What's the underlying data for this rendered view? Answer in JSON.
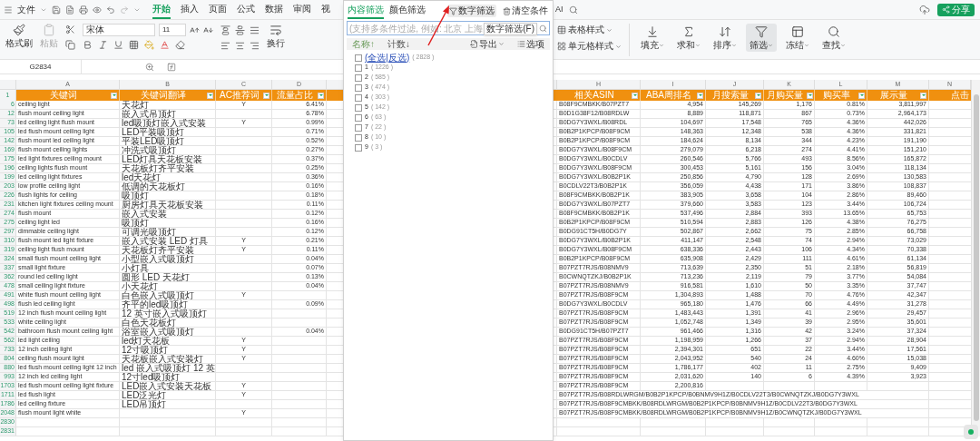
{
  "menu": {
    "file": "文件",
    "tabs": [
      {
        "label": "开始",
        "selected": true
      },
      {
        "label": "插入",
        "selected": false
      },
      {
        "label": "页面",
        "selected": false
      },
      {
        "label": "公式",
        "selected": false
      },
      {
        "label": "数据",
        "selected": false
      },
      {
        "label": "审阅",
        "selected": false
      },
      {
        "label": "视",
        "selected": false
      }
    ],
    "tail": "AI",
    "share": "分享"
  },
  "ribbon": {
    "format_painter": "格式刷",
    "paste": "粘贴",
    "font": "宋体",
    "size": "11",
    "wrap": "换行",
    "table_style": "表格样式",
    "cell_style": "单元格样式",
    "tools": [
      {
        "label": "填充",
        "active": false
      },
      {
        "label": "求和",
        "active": false
      },
      {
        "label": "排序",
        "active": false
      },
      {
        "label": "筛选",
        "active": true
      },
      {
        "label": "冻结",
        "active": false
      },
      {
        "label": "查找",
        "active": false
      }
    ]
  },
  "formula_bar": {
    "cell": "G2834"
  },
  "left_columns": [
    "A",
    "B",
    "C",
    "D"
  ],
  "right_columns": [
    "H",
    "I",
    "J",
    "K",
    "L",
    "M",
    "N"
  ],
  "header_row": "1",
  "headers_left": [
    "关键词",
    "关键词翻译",
    "AC推荐词",
    "流量占比"
  ],
  "headers_right": [
    "相关ASIN",
    "ABA周排名",
    "月搜索量",
    "月购买量",
    "购买率",
    "展示量",
    "点击"
  ],
  "rows": [
    {
      "n": "6",
      "kw": "ceiling light",
      "tr": "天花灯",
      "ac": "Y",
      "share": "6.41%",
      "asin": "B08F9CMBKK/B07PZT7",
      "rank": "4,954",
      "search": "145,269",
      "buy": "1,176",
      "rate": "0.81%",
      "views": "3,811,997"
    },
    {
      "n": "12",
      "kw": "flush mount ceiling light",
      "tr": "嵌入式吊顶灯",
      "share": "6.78%",
      "asin": "B0D1G38F12/B08RDLW",
      "rank": "8,889",
      "search": "118,871",
      "buy": "867",
      "rate": "0.73%",
      "views": "2,964,173"
    },
    {
      "n": "73",
      "kw": "led ceiling light flush mount",
      "tr": "led吸顶灯嵌入式安装",
      "ac": "Y",
      "share": "0.99%",
      "asin": "B0DG7Y3WXL/B08RDL",
      "rank": "104,697",
      "search": "17,548",
      "buy": "765",
      "rate": "4.36%",
      "views": "442,026"
    },
    {
      "n": "105",
      "kw": "led flush mount ceiling light",
      "tr": "LED平装吸顶灯",
      "share": "0.71%",
      "asin": "B0B2P1KPCP/B08F9CM",
      "rank": "148,363",
      "search": "12,348",
      "buy": "538",
      "rate": "4.36%",
      "views": "331,821"
    },
    {
      "n": "142",
      "kw": "flush mount led ceiling light",
      "tr": "平装LED吸顶灯",
      "share": "0.52%",
      "asin": "B0B2P1KPCP/B08F9CM",
      "rank": "184,624",
      "search": "8,134",
      "buy": "344",
      "rate": "4.23%",
      "views": "191,190"
    },
    {
      "n": "169",
      "kw": "flush mount ceiling lights",
      "tr": "冲洗式吸顶灯",
      "share": "0.27%",
      "asin": "B0DG7Y3WXL/B08F9CM",
      "rank": "279,079",
      "search": "6,218",
      "buy": "274",
      "rate": "4.41%",
      "views": "151,210"
    },
    {
      "n": "175",
      "kw": "led light fixtures ceiling mount",
      "tr": "LED灯具天花板安装",
      "share": "0.37%",
      "asin": "B0DG7Y3WXL/B0CDLV",
      "rank": "260,546",
      "search": "5,766",
      "buy": "493",
      "rate": "8.56%",
      "views": "165,872"
    },
    {
      "n": "196",
      "kw": "ceiling lights flush mount",
      "tr": "天花板灯齐平安装",
      "share": "0.25%",
      "asin": "B0DG7Y3WXL/B08F9CM",
      "rank": "300,453",
      "search": "5,161",
      "buy": "156",
      "rate": "3.04%",
      "views": "118,134"
    },
    {
      "n": "199",
      "kw": "led ceiling light fixtures",
      "tr": "led天花灯",
      "share": "0.36%",
      "asin": "B0DG7Y3WXL/B0B2P1K",
      "rank": "250,856",
      "search": "4,790",
      "buy": "128",
      "rate": "2.69%",
      "views": "130,583"
    },
    {
      "n": "203",
      "kw": "low profile ceiling light",
      "tr": "低调的天花板灯",
      "share": "0.16%",
      "asin": "B0CDLV22T3/B0B2P1K",
      "rank": "356,059",
      "search": "4,438",
      "buy": "171",
      "rate": "3.86%",
      "views": "108,837"
    },
    {
      "n": "226",
      "kw": "flush lights for ceiling",
      "tr": "吸顶灯",
      "share": "0.18%",
      "asin": "B08F9CMBKK/B0B2P1K",
      "rank": "383,905",
      "search": "3,658",
      "buy": "104",
      "rate": "2.86%",
      "views": "89,460"
    },
    {
      "n": "231",
      "kw": "kitchen light fixtures ceiling mount",
      "tr": "厨房灯具天花板安装",
      "share": "0.11%",
      "asin": "B0DG7Y3WXL/B07PZT7",
      "rank": "379,660",
      "search": "3,583",
      "buy": "123",
      "rate": "3.44%",
      "views": "106,724"
    },
    {
      "n": "274",
      "kw": "flush mount",
      "tr": "嵌入式安装",
      "share": "0.12%",
      "asin": "B08F9CMBKK/B0B2P1K",
      "rank": "537,496",
      "search": "2,884",
      "buy": "393",
      "rate": "13.65%",
      "views": "65,753"
    },
    {
      "n": "275",
      "kw": "ceiling light led",
      "tr": "吸顶灯",
      "share": "0.16%",
      "asin": "B0B2P1KPCP/B08F9CM",
      "rank": "510,594",
      "search": "2,883",
      "buy": "126",
      "rate": "4.38%",
      "views": "76,275"
    },
    {
      "n": "297",
      "kw": "dimmable ceiling light",
      "tr": "可调光吸顶灯",
      "share": "0.12%",
      "asin": "B0DG91CT5H/B0DG7Y",
      "rank": "502,867",
      "search": "2,662",
      "buy": "75",
      "rate": "2.85%",
      "views": "66,758"
    },
    {
      "n": "310",
      "kw": "flush mount led light fixture",
      "tr": "嵌入式安装 LED 灯具",
      "ac": "Y",
      "share": "0.21%",
      "asin": "B0DG7Y3WXL/B0B2P1K",
      "rank": "411,147",
      "search": "2,548",
      "buy": "74",
      "rate": "2.94%",
      "views": "73,029"
    },
    {
      "n": "319",
      "kw": "ceiling light flush mount",
      "tr": "天花板灯齐平安装",
      "ac": "Y",
      "share": "0.11%",
      "asin": "B0DG7Y3WXL/B08F9CM",
      "rank": "638,336",
      "search": "2,443",
      "buy": "106",
      "rate": "4.34%",
      "views": "70,338"
    },
    {
      "n": "324",
      "kw": "small flush mount ceiling light",
      "tr": "小型嵌入式吸顶灯",
      "share": "0.04%",
      "asin": "B0B2P1KPCP/B08F9CM",
      "rank": "635,908",
      "search": "2,429",
      "buy": "111",
      "rate": "4.61%",
      "views": "61,134"
    },
    {
      "n": "337",
      "kw": "small light fixture",
      "tr": "小灯具",
      "share": "0.07%",
      "asin": "B07PZT7RJS/B08NMV9",
      "rank": "713,639",
      "search": "2,350",
      "buy": "51",
      "rate": "2.18%",
      "views": "56,819"
    },
    {
      "n": "362",
      "kw": "round led ceiling light",
      "tr": "圆形 LED 天花灯",
      "share": "0.13%",
      "asin": "B0CWNQTZKJ/B0B2P1K",
      "rank": "713,236",
      "search": "2,119",
      "buy": "79",
      "rate": "3.77%",
      "views": "54,084"
    },
    {
      "n": "478",
      "kw": "small ceiling light fixture",
      "tr": "小天花灯",
      "share": "0.04%",
      "asin": "B07PZT7RJS/B08NMV9",
      "rank": "916,581",
      "search": "1,610",
      "buy": "50",
      "rate": "3.35%",
      "views": "37,747"
    },
    {
      "n": "491",
      "kw": "white flush mount ceiling light",
      "tr": "白色嵌入式吸顶灯",
      "ac": "Y",
      "asin": "B07PZT7RJS/B08F9CM",
      "rank": "1,304,893",
      "search": "1,488",
      "buy": "70",
      "rate": "4.76%",
      "views": "42,347"
    },
    {
      "n": "498",
      "kw": "flush led ceiling light",
      "tr": "齐平的led吸顶灯",
      "share": "0.09%",
      "asin": "B0DG7Y3WXL/B0CDLV",
      "rank": "965,180",
      "search": "1,476",
      "buy": "66",
      "rate": "4.49%",
      "views": "31,278"
    },
    {
      "n": "519",
      "kw": "12 inch flush mount ceiling light",
      "tr": "12 英寸嵌入式吸顶灯",
      "asin": "B07PZT7RJS/B08F9CM",
      "rank": "1,483,443",
      "search": "1,391",
      "buy": "41",
      "rate": "2.96%",
      "views": "29,457"
    },
    {
      "n": "533",
      "kw": "white ceiling light",
      "tr": "白色天花板灯",
      "asin": "B07PZT7RJS/B08F9CM",
      "rank": "1,052,748",
      "search": "1,349",
      "buy": "39",
      "rate": "2.95%",
      "views": "35,601"
    },
    {
      "n": "542",
      "kw": "bathroom flush mount ceiling light",
      "tr": "浴室嵌入式吸顶灯",
      "share": "0.04%",
      "asin": "B0DG91CT5H/B07PZT7",
      "rank": "961,466",
      "search": "1,316",
      "buy": "42",
      "rate": "3.24%",
      "views": "37,324"
    },
    {
      "n": "562",
      "kw": "led light ceiling",
      "tr": "led灯天花板",
      "ac": "Y",
      "asin": "B07PZT7RJS/B08F9CM",
      "rank": "1,198,959",
      "search": "1,266",
      "buy": "37",
      "rate": "2.94%",
      "views": "28,904"
    },
    {
      "n": "733",
      "kw": "12 inch ceiling light",
      "tr": "12寸吸顶灯",
      "ac": "Y",
      "asin": "B07PZT7RJS/B08F9CM",
      "rank": "2,394,301",
      "search": "651",
      "buy": "22",
      "rate": "3.44%",
      "views": "17,561"
    },
    {
      "n": "804",
      "kw": "ceiling flush mount light",
      "tr": "天花板嵌入式安装灯",
      "ac": "Y",
      "asin": "B07PZT7RJS/B08F9CM",
      "rank": "2,043,952",
      "search": "540",
      "buy": "24",
      "rate": "4.60%",
      "views": "15,038"
    },
    {
      "n": "880",
      "kw": "led flush mount ceiling light 12 inch",
      "tr": "led 嵌入式吸顶灯 12 英",
      "asin": "B07PZT7RJS/B08F9CM",
      "rank": "1,786,177",
      "search": "402",
      "buy": "11",
      "rate": "2.75%",
      "views": "9,409"
    },
    {
      "n": "993",
      "kw": "12 inch led ceiling light",
      "tr": "12寸led吸顶灯",
      "asin": "B07PZT7RJS/B08F9CM",
      "rank": "2,031,620",
      "search": "140",
      "buy": "6",
      "rate": "4.39%",
      "views": "3,923"
    },
    {
      "n": "1703",
      "kw": "led flush mount ceiling light fixture",
      "tr": "LED嵌入式安装天花板",
      "ac": "Y",
      "asin": "B07PZT7RJS/B08F9CM",
      "rank": "2,200,816"
    },
    {
      "n": "1711",
      "kw": "led flush light",
      "tr": "LED泛光灯",
      "ac": "Y",
      "asin": "B07PZT7RJS/B08RDLWRGM/B0B2P1KPCP/B0BNMV9H1Z/B0CDLV22T3/B0CWNQTZKJ/B0DG7Y3WXL"
    },
    {
      "n": "1786",
      "kw": "led ceiling fixture",
      "tr": "LED吊顶灯",
      "asin": "B07PZT7RJS/B08F9CMBKK/B08RDLWRGM/B0B2P1KPCP/B0BNMV9H1Z/B0CDLV22T3/B0DG7Y3WXL"
    },
    {
      "n": "2048",
      "kw": "flush mount light white",
      "ac": "Y",
      "asin": "B07PZT7RJS/B08F9CMBKK/B08RDLWRGM/B0B2P1KPCP/B0BNMV9H1Z/B0CWNQTZKJ/B0DG7Y3WXL"
    }
  ],
  "empty_rows": [
    "2830",
    "2831"
  ],
  "filter_panel": {
    "tabs": [
      {
        "label": "内容筛选",
        "selected": true
      },
      {
        "label": "颜色筛选",
        "selected": false
      }
    ],
    "number_filter": "数字筛选",
    "clear": "清空条件",
    "search_placeholder": "(支持多条件过滤, 例如: 北京 上海",
    "tooltip": "数字筛选(F)",
    "sort_name": "名称↑",
    "sort_count": "计数↓",
    "export": "导出",
    "options": "选项",
    "select_all": {
      "label": "(全选|反选)",
      "count": "( 2828 )",
      "checked": false
    },
    "items": [
      {
        "label": "1",
        "count": "( 1226 )",
        "checked": false
      },
      {
        "label": "2",
        "count": "( 585 )",
        "checked": false
      },
      {
        "label": "3",
        "count": "( 474 )",
        "checked": false
      },
      {
        "label": "4",
        "count": "( 303 )",
        "checked": false
      },
      {
        "label": "5",
        "count": "( 142 )",
        "checked": false
      },
      {
        "label": "6",
        "count": "( 63 )",
        "checked": false
      },
      {
        "label": "7",
        "count": "( 22 )",
        "checked": false
      },
      {
        "label": "8",
        "count": "( 10 )",
        "checked": false
      },
      {
        "label": "9",
        "count": "( 3 )",
        "checked": false
      }
    ]
  }
}
